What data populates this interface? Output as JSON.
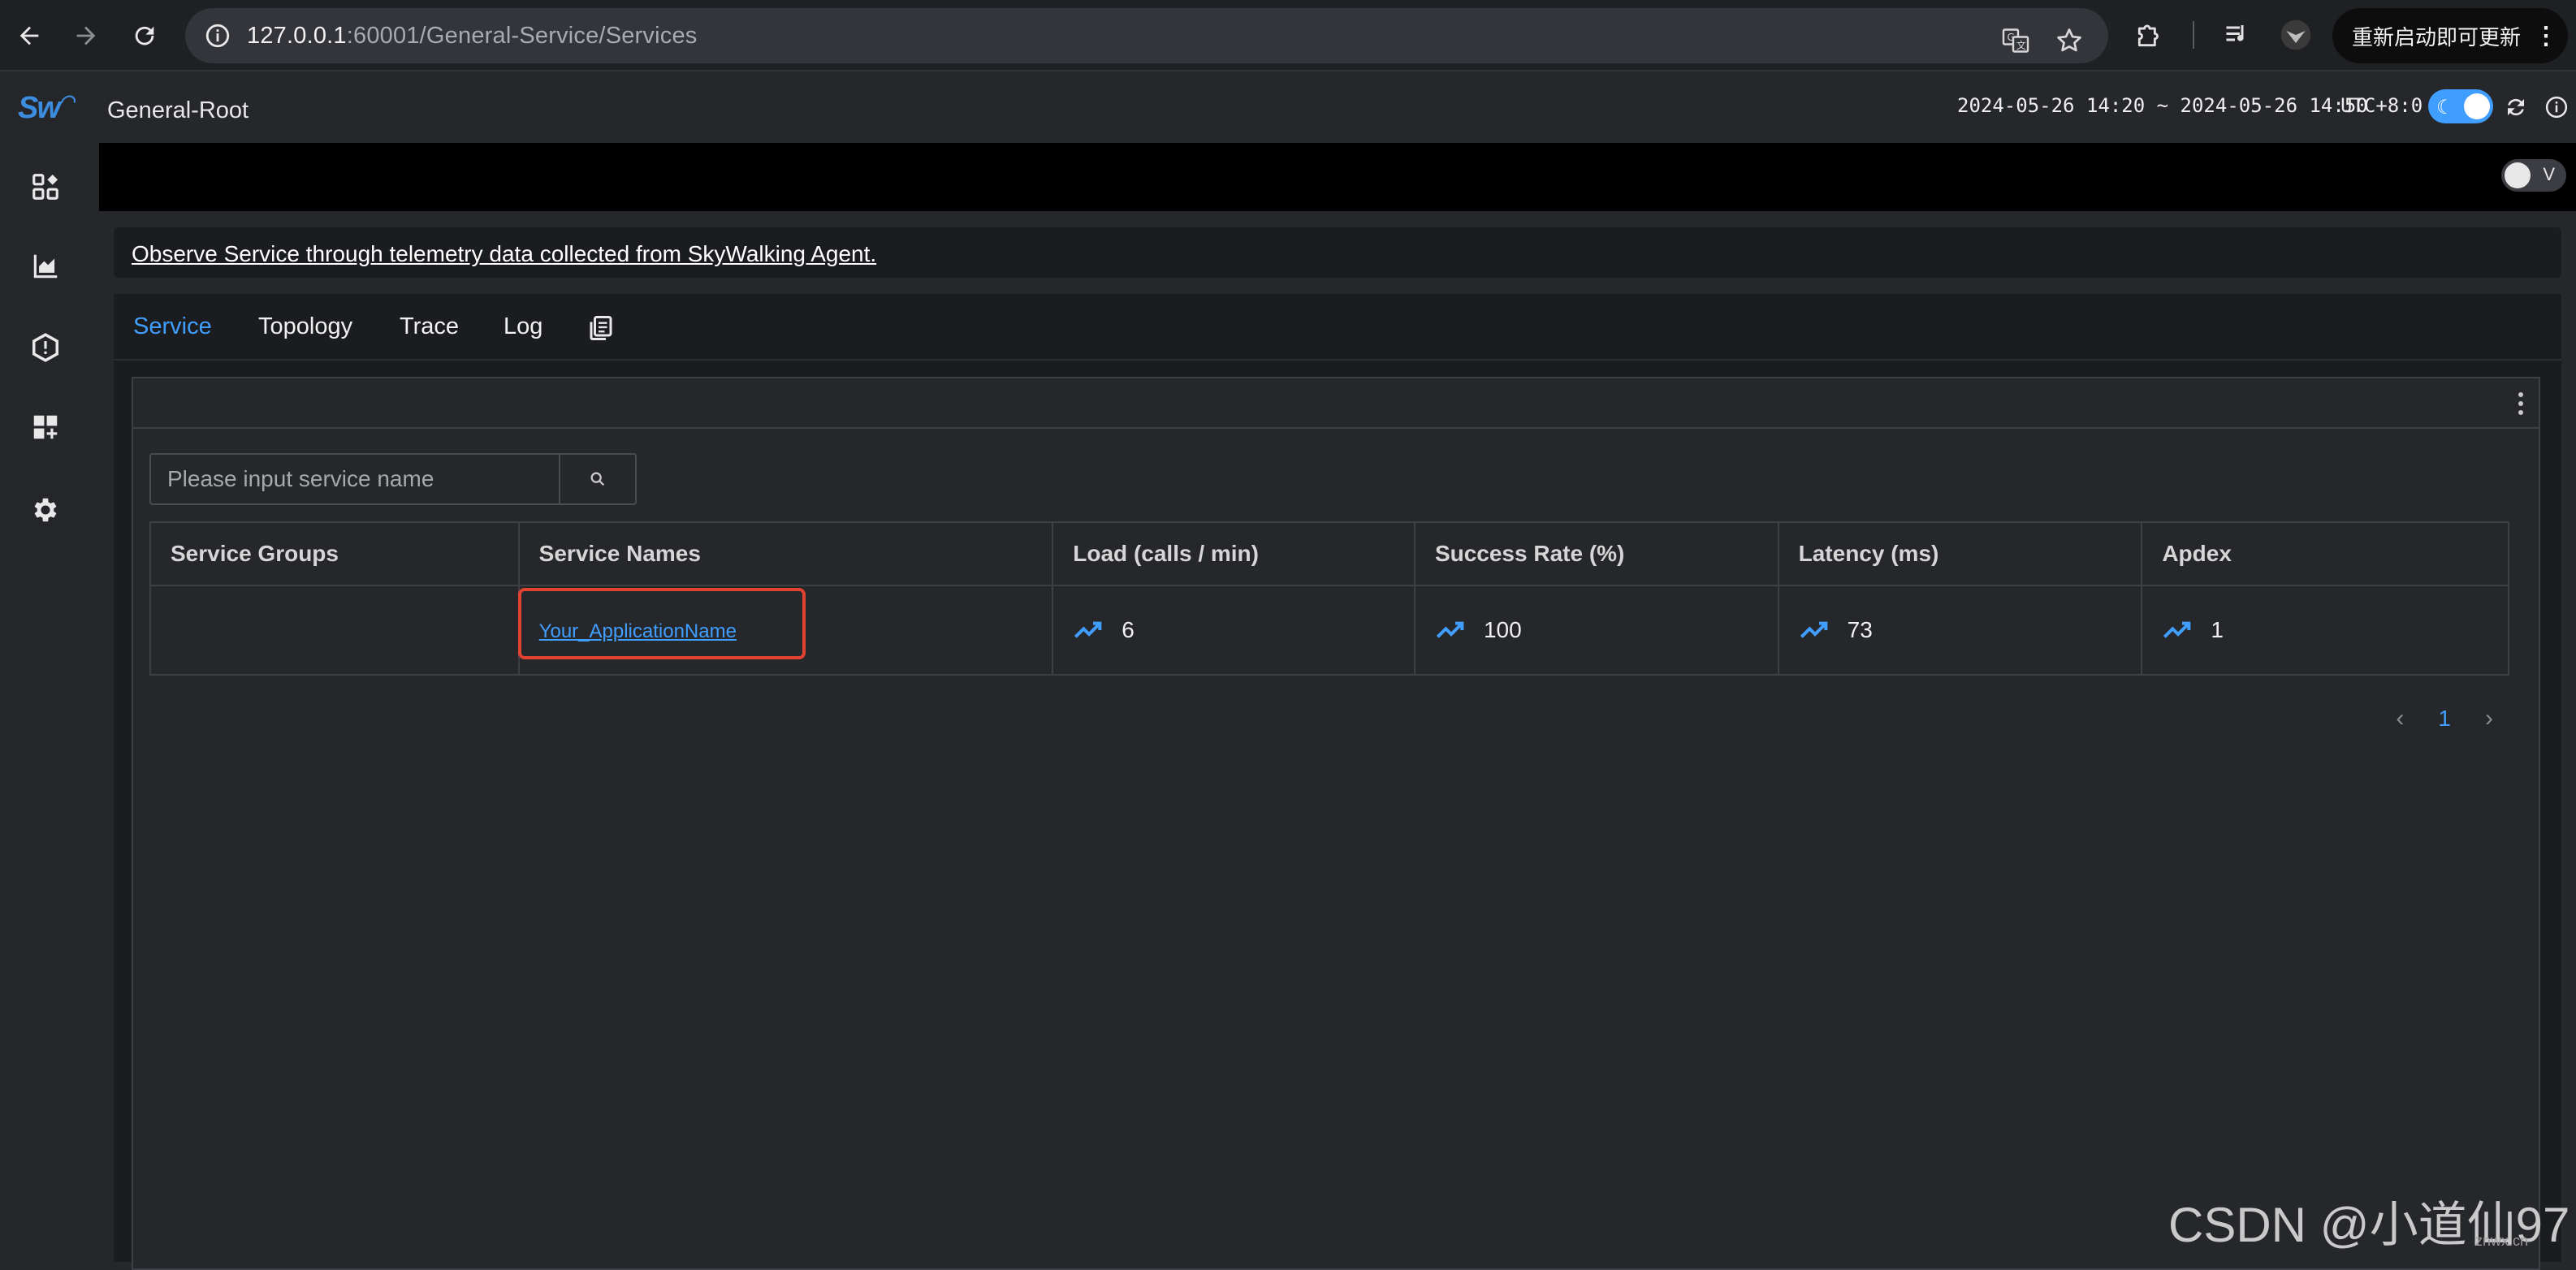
{
  "browser": {
    "url_host": "127.0.0.1",
    "url_path": ":60001/General-Service/Services",
    "update_label": "重新启动即可更新"
  },
  "sidebar": {
    "logo": "Sw",
    "items": [
      {
        "icon": "dashboard-icon"
      },
      {
        "icon": "chart-icon"
      },
      {
        "icon": "alert-icon"
      },
      {
        "icon": "add-dashboard-icon"
      },
      {
        "icon": "settings-icon"
      }
    ]
  },
  "header": {
    "title": "General-Root",
    "time_range": "2024-05-26 14:20 ~ 2024-05-26 14:50",
    "timezone": "UTC+8:0"
  },
  "toolbar": {
    "toggle_label": "V"
  },
  "banner": {
    "text": "Observe Service through telemetry data collected from SkyWalking Agent."
  },
  "tabs": [
    {
      "label": "Service",
      "active": true
    },
    {
      "label": "Topology"
    },
    {
      "label": "Trace"
    },
    {
      "label": "Log"
    }
  ],
  "search": {
    "placeholder": "Please input service name",
    "value": ""
  },
  "table": {
    "columns": [
      "Service Groups",
      "Service Names",
      "Load (calls / min)",
      "Success Rate (%)",
      "Latency (ms)",
      "Apdex"
    ],
    "rows": [
      {
        "group": "",
        "name": "Your_ApplicationName",
        "load": "6",
        "success_rate": "100",
        "latency": "73",
        "apdex": "1"
      }
    ]
  },
  "pagination": {
    "current": "1"
  },
  "watermark": {
    "text": "CSDN @小道仙97",
    "small": "znwx.cn"
  },
  "colors": {
    "accent": "#409eff",
    "highlight": "#e0432f",
    "background": "#26272b"
  }
}
